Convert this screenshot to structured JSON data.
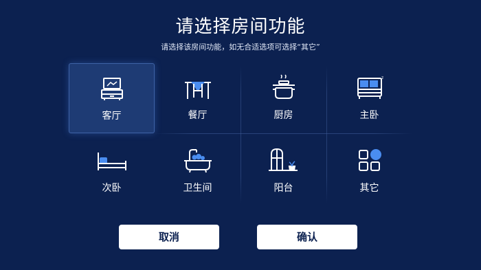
{
  "dialog": {
    "title": "请选择房间功能",
    "subtitle": "请选择该房间功能，如无合适选项可选择“其它”"
  },
  "rooms": [
    {
      "label": "客厅",
      "icon": "tv-cabinet-icon",
      "selected": true
    },
    {
      "label": "餐厅",
      "icon": "dining-table-icon",
      "selected": false
    },
    {
      "label": "厨房",
      "icon": "cooking-pot-icon",
      "selected": false
    },
    {
      "label": "主卧",
      "icon": "double-bed-icon",
      "selected": false
    },
    {
      "label": "次卧",
      "icon": "single-bed-icon",
      "selected": false
    },
    {
      "label": "卫生间",
      "icon": "bathtub-icon",
      "selected": false
    },
    {
      "label": "阳台",
      "icon": "balcony-door-icon",
      "selected": false
    },
    {
      "label": "其它",
      "icon": "grid-more-icon",
      "selected": false
    }
  ],
  "buttons": {
    "cancel_label": "取消",
    "confirm_label": "确认"
  },
  "colors": {
    "background": "#0c2150",
    "selected_tile": "#1e3b74",
    "accent_blue": "#4a8df0",
    "button_bg": "#ffffff"
  }
}
